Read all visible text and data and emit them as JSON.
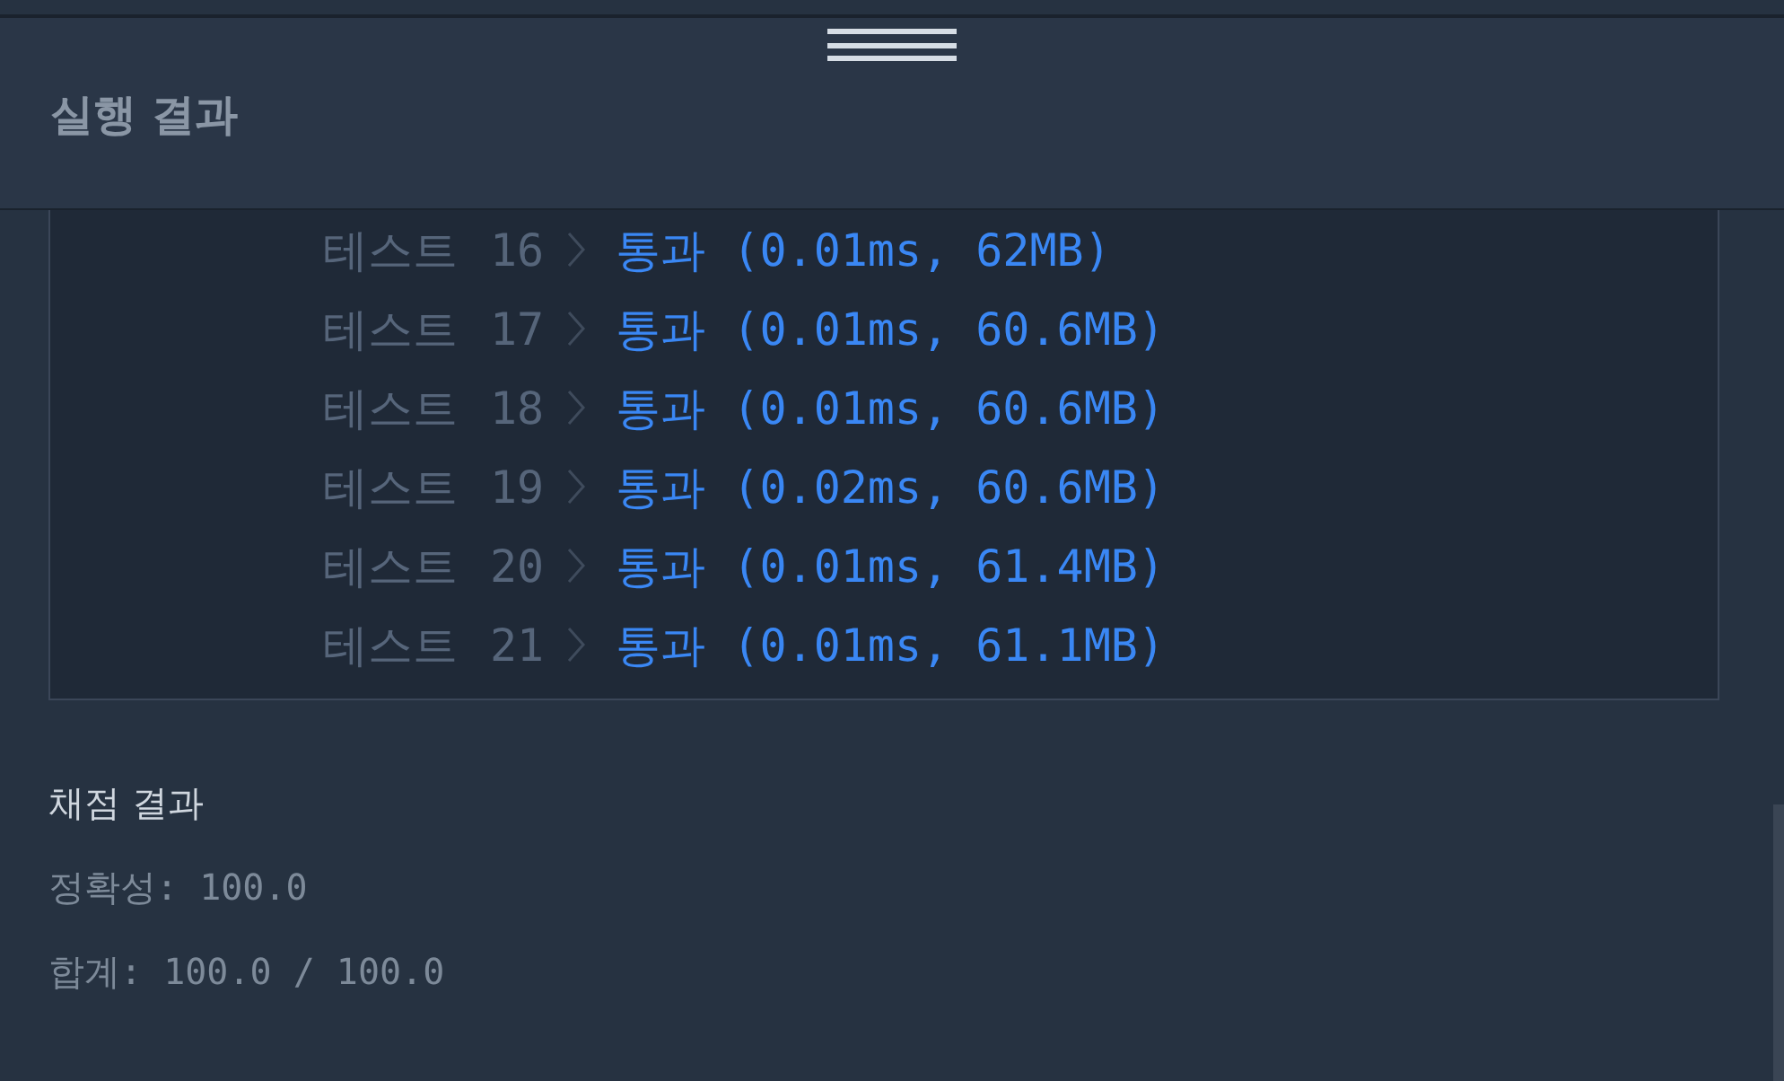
{
  "header": {
    "title": "실행 결과"
  },
  "results": [
    {
      "label": "테스트",
      "number": "16",
      "status": "통과 (0.01ms, 62MB)"
    },
    {
      "label": "테스트",
      "number": "17",
      "status": "통과 (0.01ms, 60.6MB)"
    },
    {
      "label": "테스트",
      "number": "18",
      "status": "통과 (0.01ms, 60.6MB)"
    },
    {
      "label": "테스트",
      "number": "19",
      "status": "통과 (0.02ms, 60.6MB)"
    },
    {
      "label": "테스트",
      "number": "20",
      "status": "통과 (0.01ms, 61.4MB)"
    },
    {
      "label": "테스트",
      "number": "21",
      "status": "통과 (0.01ms, 61.1MB)"
    }
  ],
  "grading": {
    "title": "채점 결과",
    "lines": [
      "정확성: 100.0",
      "합계: 100.0 / 100.0"
    ]
  }
}
